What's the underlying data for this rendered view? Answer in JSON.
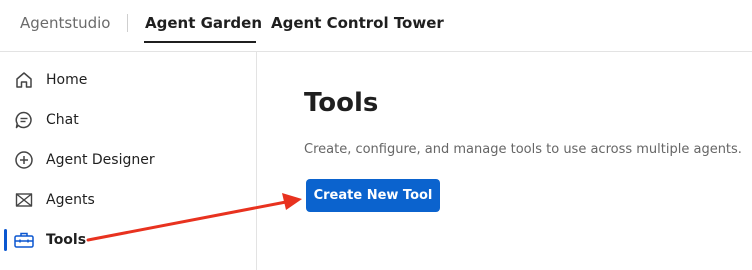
{
  "header": {
    "brand": "Agentstudio",
    "tabs": [
      {
        "label": "Agent Garden",
        "selected": true
      },
      {
        "label": "Agent Control Tower",
        "selected": false
      }
    ]
  },
  "sidebar": {
    "items": [
      {
        "label": "Home",
        "icon": "home-icon"
      },
      {
        "label": "Chat",
        "icon": "chat-icon"
      },
      {
        "label": "Agent Designer",
        "icon": "plus-circle-icon"
      },
      {
        "label": "Agents",
        "icon": "agents-icon"
      },
      {
        "label": "Tools",
        "icon": "toolbox-icon",
        "active": true
      }
    ]
  },
  "main": {
    "title": "Tools",
    "description": "Create, configure, and manage tools to use across multiple agents.",
    "primary_button": "Create New Tool"
  },
  "colors": {
    "accent": "#0b63ce",
    "annotation": "#e8321f",
    "active_indicator": "#0b57d0"
  }
}
